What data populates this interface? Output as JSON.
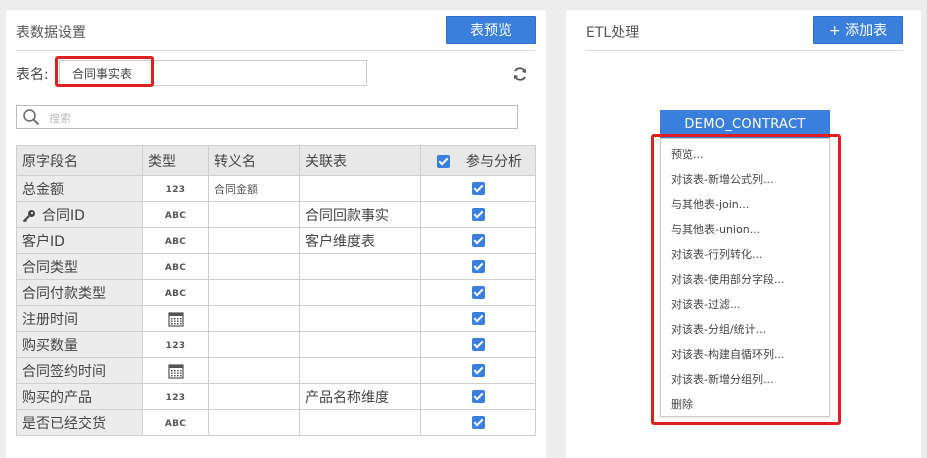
{
  "left": {
    "title": "表数据设置",
    "preview_button": "表预览",
    "name_label": "表名:",
    "name_value": "合同事实表",
    "search_placeholder": "搜索",
    "columns": [
      "原字段名",
      "类型",
      "转义名",
      "关联表",
      "参与分析"
    ],
    "rows": [
      {
        "name": "总金额",
        "type": "123",
        "alias": "合同金额",
        "relation": "",
        "checked": true,
        "key": false
      },
      {
        "name": "合同ID",
        "type": "ABC",
        "alias": "",
        "relation": "合同回款事实",
        "checked": true,
        "key": true
      },
      {
        "name": "客户ID",
        "type": "ABC",
        "alias": "",
        "relation": "客户维度表",
        "checked": true,
        "key": false
      },
      {
        "name": "合同类型",
        "type": "ABC",
        "alias": "",
        "relation": "",
        "checked": true,
        "key": false
      },
      {
        "name": "合同付款类型",
        "type": "ABC",
        "alias": "",
        "relation": "",
        "checked": true,
        "key": false
      },
      {
        "name": "注册时间",
        "type": "date",
        "alias": "",
        "relation": "",
        "checked": true,
        "key": false
      },
      {
        "name": "购买数量",
        "type": "123",
        "alias": "",
        "relation": "",
        "checked": true,
        "key": false
      },
      {
        "name": "合同签约时间",
        "type": "date",
        "alias": "",
        "relation": "",
        "checked": true,
        "key": false
      },
      {
        "name": "购买的产品",
        "type": "123",
        "alias": "",
        "relation": "产品名称维度",
        "checked": true,
        "key": false
      },
      {
        "name": "是否已经交货",
        "type": "ABC",
        "alias": "",
        "relation": "",
        "checked": true,
        "key": false
      }
    ]
  },
  "right": {
    "title": "ETL处理",
    "add_button": "+ 添加表",
    "node_label": "DEMO_CONTRACT",
    "menu": [
      "预览...",
      "对该表-新增公式列...",
      "与其他表-join...",
      "与其他表-union...",
      "对该表-行列转化...",
      "对该表-使用部分字段...",
      "对该表-过滤...",
      "对该表-分组/统计...",
      "对该表-构建自循环列...",
      "对该表-新增分组列...",
      "删除"
    ]
  },
  "colors": {
    "accent": "#3b7fdd",
    "highlight": "#e02020"
  }
}
